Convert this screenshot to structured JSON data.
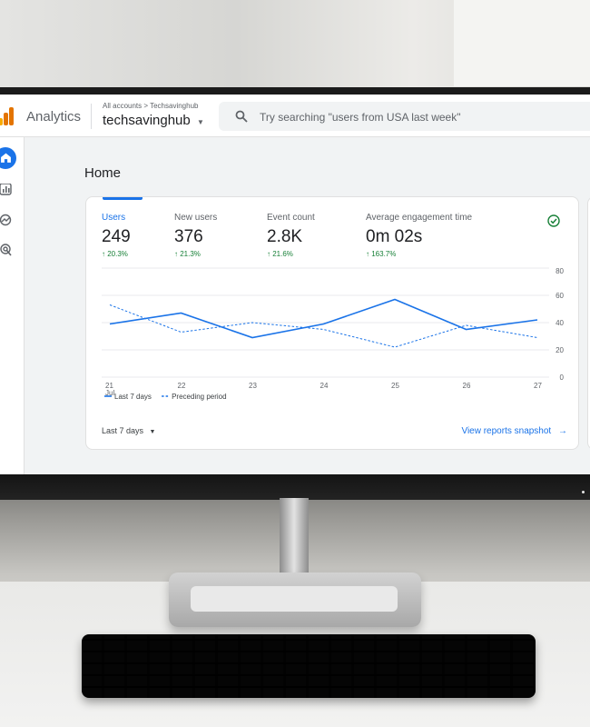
{
  "topbar": {
    "app_name": "Analytics",
    "breadcrumb": "All accounts > Techsavinghub",
    "account": "techsavinghub",
    "search_placeholder": "Try searching \"users from USA last week\""
  },
  "page": {
    "title": "Home"
  },
  "metrics": [
    {
      "label": "Users",
      "value": "249",
      "delta": "↑ 20.3%"
    },
    {
      "label": "New users",
      "value": "376",
      "delta": "↑ 21.3%"
    },
    {
      "label": "Event count",
      "value": "2.8K",
      "delta": "↑ 21.6%"
    },
    {
      "label": "Average engagement time",
      "value": "0m 02s",
      "delta": "↑ 163.7%"
    }
  ],
  "footer": {
    "range": "Last 7 days",
    "link": "View reports snapshot"
  },
  "colors": {
    "accent": "#1a73e8",
    "positive": "#188038"
  },
  "icons": [
    "analytics-logo-icon",
    "search-icon",
    "home-icon",
    "reports-icon",
    "explore-icon",
    "advertising-icon",
    "check-circle-icon",
    "arrow-right-icon",
    "chevron-down-icon"
  ],
  "chart_data": {
    "type": "line",
    "x": [
      "21",
      "22",
      "23",
      "24",
      "25",
      "26",
      "27"
    ],
    "x_sublabel": "Jul",
    "ylim": [
      0,
      80
    ],
    "yticks": [
      "0",
      "20",
      "40",
      "60",
      "80"
    ],
    "series": [
      {
        "name": "Last 7 days",
        "style": "solid",
        "values": [
          39,
          47,
          29,
          39,
          57,
          35,
          42
        ]
      },
      {
        "name": "Preceding period",
        "style": "dashed",
        "values": [
          53,
          33,
          40,
          35,
          22,
          38,
          29
        ]
      }
    ],
    "grid": true,
    "legend_position": "bottom-left"
  }
}
